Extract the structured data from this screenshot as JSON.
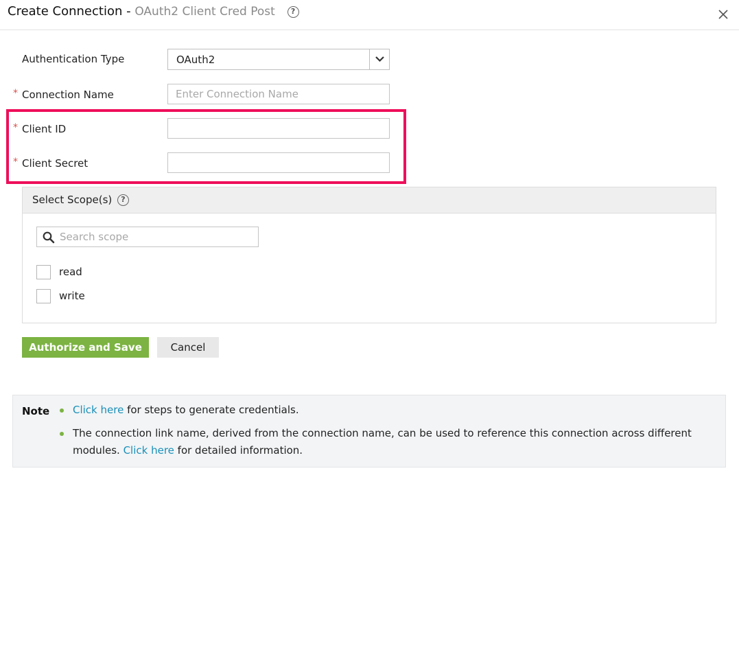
{
  "header": {
    "title": "Create Connection -",
    "subtitle": "OAuth2 Client Cred Post"
  },
  "form": {
    "auth_type_label": "Authentication Type",
    "auth_type_value": "OAuth2",
    "connection_name_label": "Connection Name",
    "connection_name_placeholder": "Enter Connection Name",
    "client_id_label": "Client ID",
    "client_secret_label": "Client Secret",
    "required_marker": "*"
  },
  "scopes": {
    "title": "Select Scope(s)",
    "search_placeholder": "Search scope",
    "items": [
      {
        "label": "read",
        "checked": false
      },
      {
        "label": "write",
        "checked": false
      }
    ]
  },
  "actions": {
    "authorize_label": "Authorize and Save",
    "cancel_label": "Cancel"
  },
  "note": {
    "title": "Note",
    "item1_link": "Click here",
    "item1_text": " for steps to generate credentials.",
    "item2_text": "The connection link name, derived from the connection name, can be used to reference this connection across different modules. ",
    "item2_link": "Click here",
    "item2_tail": " for detailed information."
  },
  "colors": {
    "highlight": "#ee0f5b",
    "primary_button": "#7cb342",
    "link": "#1a8fb8",
    "required": "#d9534f"
  },
  "icons": {
    "help": "question-circle-icon",
    "close": "close-icon",
    "dropdown": "chevron-down-icon",
    "search": "search-icon"
  }
}
